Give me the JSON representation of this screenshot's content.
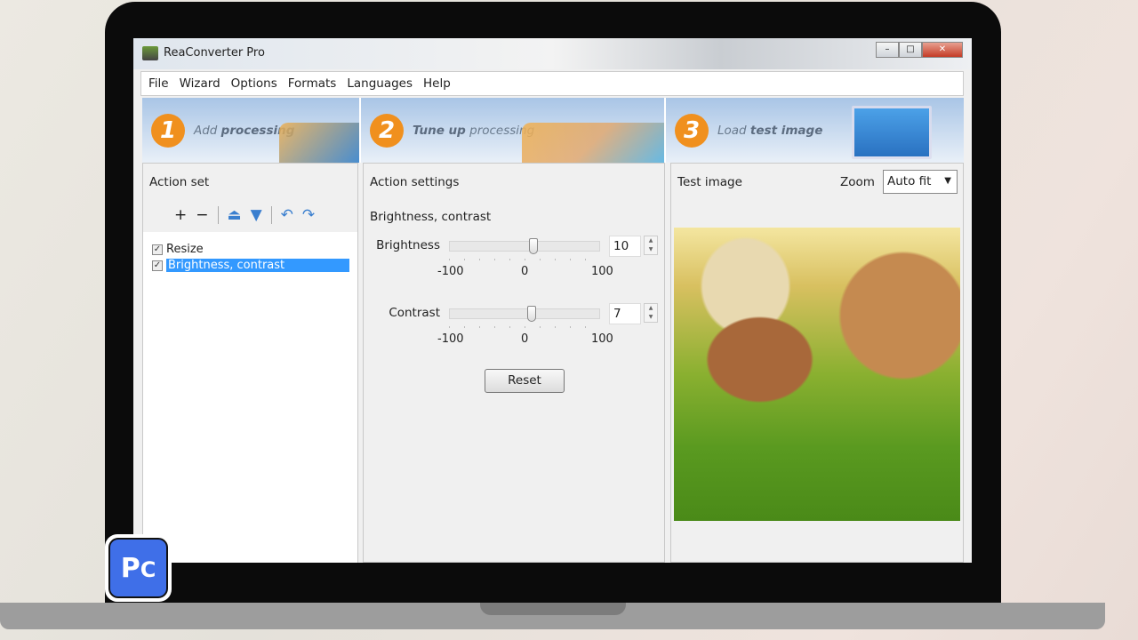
{
  "window": {
    "title": "ReaConverter Pro",
    "controls": [
      "–",
      "□",
      "✕"
    ]
  },
  "menu": [
    "File",
    "Wizard",
    "Options",
    "Formats",
    "Languages",
    "Help"
  ],
  "steps": [
    {
      "num": "1",
      "light": "Add",
      "bold": "processing"
    },
    {
      "num": "2",
      "bold": "Tune up",
      "light": "processing"
    },
    {
      "num": "3",
      "light": "Load",
      "bold": "test image"
    }
  ],
  "action_set": {
    "title": "Action set",
    "toolbar": [
      "+",
      "−",
      "⏏",
      "▼",
      "↶",
      "↷"
    ],
    "items": [
      {
        "label": "Resize",
        "checked": true,
        "selected": false
      },
      {
        "label": "Brightness, contrast",
        "checked": true,
        "selected": true
      }
    ]
  },
  "action_settings": {
    "title": "Action settings",
    "subtitle": "Brightness, contrast",
    "brightness": {
      "label": "Brightness",
      "value": "10",
      "min": "-100",
      "mid": "0",
      "max": "100"
    },
    "contrast": {
      "label": "Contrast",
      "value": "7",
      "min": "-100",
      "mid": "0",
      "max": "100"
    },
    "reset_label": "Reset"
  },
  "test_image": {
    "title": "Test image",
    "zoom_label": "Zoom",
    "zoom_value": "Auto fit"
  },
  "logo_text": "PC"
}
